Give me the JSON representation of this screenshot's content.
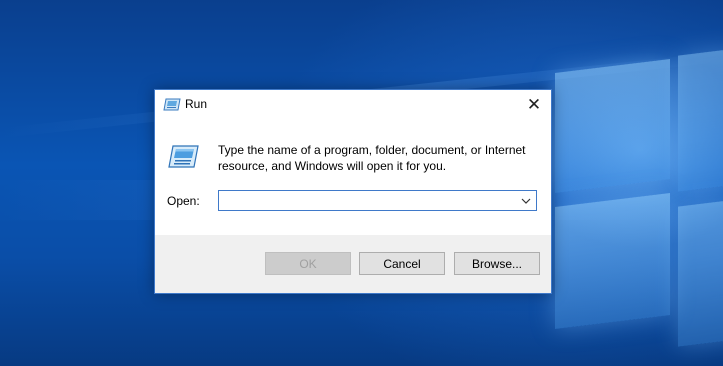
{
  "dialog": {
    "title": "Run",
    "close_glyph": "✕",
    "description": "Type the name of a program, folder, document, or Internet resource, and Windows will open it for you.",
    "open_label": "Open:",
    "open_value": "",
    "buttons": {
      "ok": "OK",
      "cancel": "Cancel",
      "browse": "Browse..."
    },
    "icons": {
      "title": "run-icon",
      "big": "run-icon",
      "dropdown": "chevron-down-icon",
      "close": "close-icon"
    },
    "colors": {
      "accent": "#3f79c9",
      "footer": "#f0f0f0",
      "disabled_text": "#a0a0a0"
    }
  },
  "desktop": {
    "wallpaper": "windows-10-hero",
    "colors": {
      "background": "#0a55b4",
      "glow": "#96d2ff"
    }
  }
}
